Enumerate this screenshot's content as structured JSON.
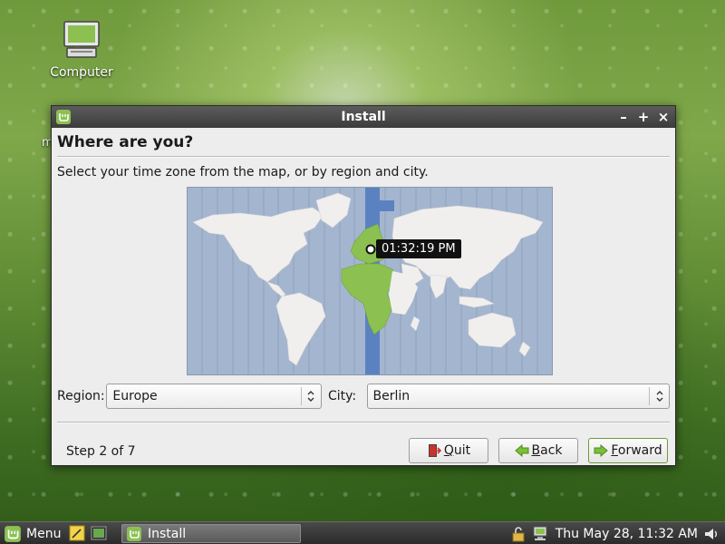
{
  "desktop": {
    "icons": [
      {
        "label": "Computer",
        "icon": "computer-icon"
      }
    ],
    "partial_label": "m"
  },
  "window": {
    "title": "Install",
    "page_title": "Where are you?",
    "instruction": "Select your time zone from the map, or by region and city.",
    "map": {
      "tooltip_time": "01:32:19 PM",
      "highlight_color": "#8cc152",
      "ocean_color": "#a4b5cf",
      "band_color": "#5b82c0"
    },
    "region": {
      "label": "Region:",
      "value": "Europe"
    },
    "city": {
      "label": "City:",
      "value": "Berlin"
    },
    "step": "Step 2 of 7",
    "buttons": {
      "quit": {
        "mnemonic": "Q",
        "rest": "uit"
      },
      "back": {
        "mnemonic": "B",
        "rest": "ack"
      },
      "forward": {
        "mnemonic": "F",
        "rest": "orward"
      }
    }
  },
  "taskbar": {
    "menu_label": "Menu",
    "task_label": "Install",
    "clock": "Thu May 28, 11:32 AM"
  },
  "colors": {
    "mint_green": "#8cc152",
    "titlebar": "#4a4a4a"
  }
}
